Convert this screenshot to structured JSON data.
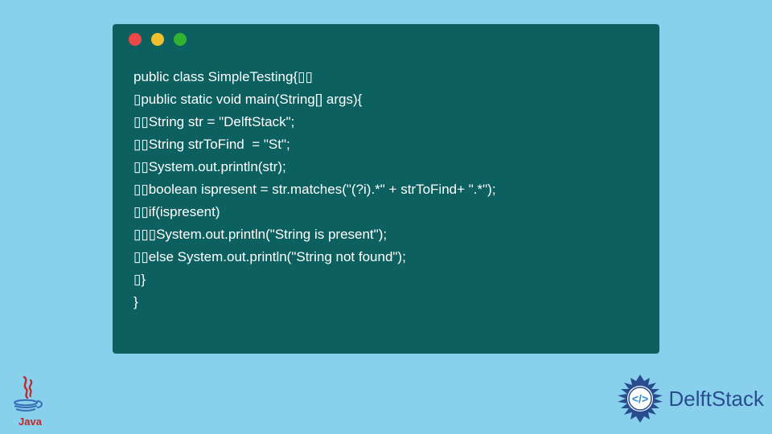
{
  "window": {
    "dots": [
      "#ed4747",
      "#f0c02e",
      "#32b32f"
    ]
  },
  "code": {
    "lines": [
      "public class SimpleTesting{▯▯",
      "▯public static void main(String[] args){",
      "▯▯String str = \"DelftStack\";",
      "▯▯String strToFind  = \"St\";",
      "▯▯System.out.println(str);",
      "▯▯boolean ispresent = str.matches(\"(?i).*\" + strToFind+ \".*\");",
      "▯▯if(ispresent)",
      "▯▯▯System.out.println(\"String is present\");",
      "▯▯else System.out.println(\"String not found\");",
      "▯}",
      "}"
    ]
  },
  "branding": {
    "java_label": "Java",
    "delft_label": "DelftStack"
  }
}
